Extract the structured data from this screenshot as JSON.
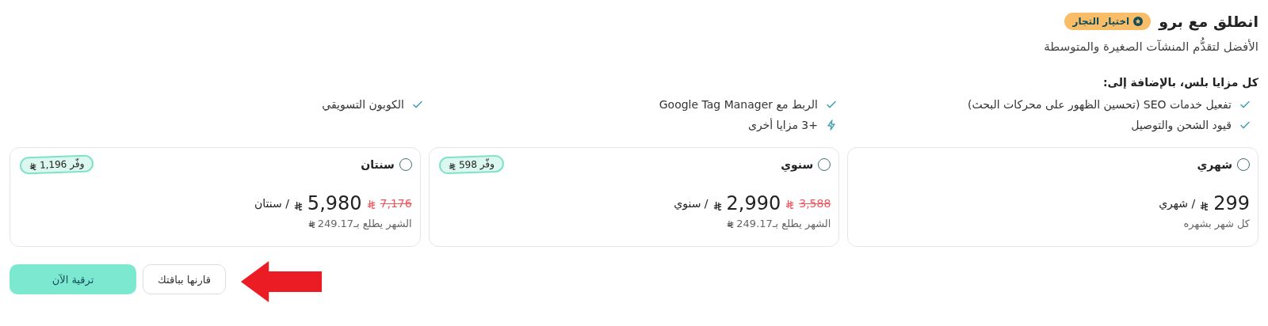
{
  "header": {
    "title": "انطلق مع برو",
    "badge": "اختيار التجار",
    "subtitle": "الأفضل لتقدُّم المنشآت الصغيرة والمتوسطة"
  },
  "features": {
    "heading": "كل مزايا بلس، بالإضافة إلى:",
    "items": [
      {
        "kind": "check",
        "label": "تفعيل خدمات SEO (تحسين الظهور على محركات البحث)"
      },
      {
        "kind": "check",
        "label": "الربط مع Google Tag Manager"
      },
      {
        "kind": "check",
        "label": "الكوبون التسويقي"
      },
      {
        "kind": "check",
        "label": "قيود الشحن والتوصيل"
      },
      {
        "kind": "bolt",
        "label": "+3 مزايا أخرى"
      }
    ]
  },
  "plans": [
    {
      "name": "شهري",
      "selected": false,
      "price": "299",
      "period": "/ شهري",
      "note": "كل شهر بشهره",
      "note_currency": false
    },
    {
      "name": "سنوي",
      "selected": false,
      "price": "2,990",
      "old_price": "3,588",
      "period": "/ سنوي",
      "note": "الشهر يطلع بـ249.17",
      "note_currency": true,
      "savings": "وفّر 598"
    },
    {
      "name": "سنتان",
      "selected": false,
      "price": "5,980",
      "old_price": "7,176",
      "period": "/ سنتان",
      "note": "الشهر يطلع بـ249.17",
      "note_currency": true,
      "savings": "وفّر 1,196"
    }
  ],
  "buttons": {
    "compare": "قارنها بباقتك",
    "upgrade": "ترقية الآن"
  }
}
